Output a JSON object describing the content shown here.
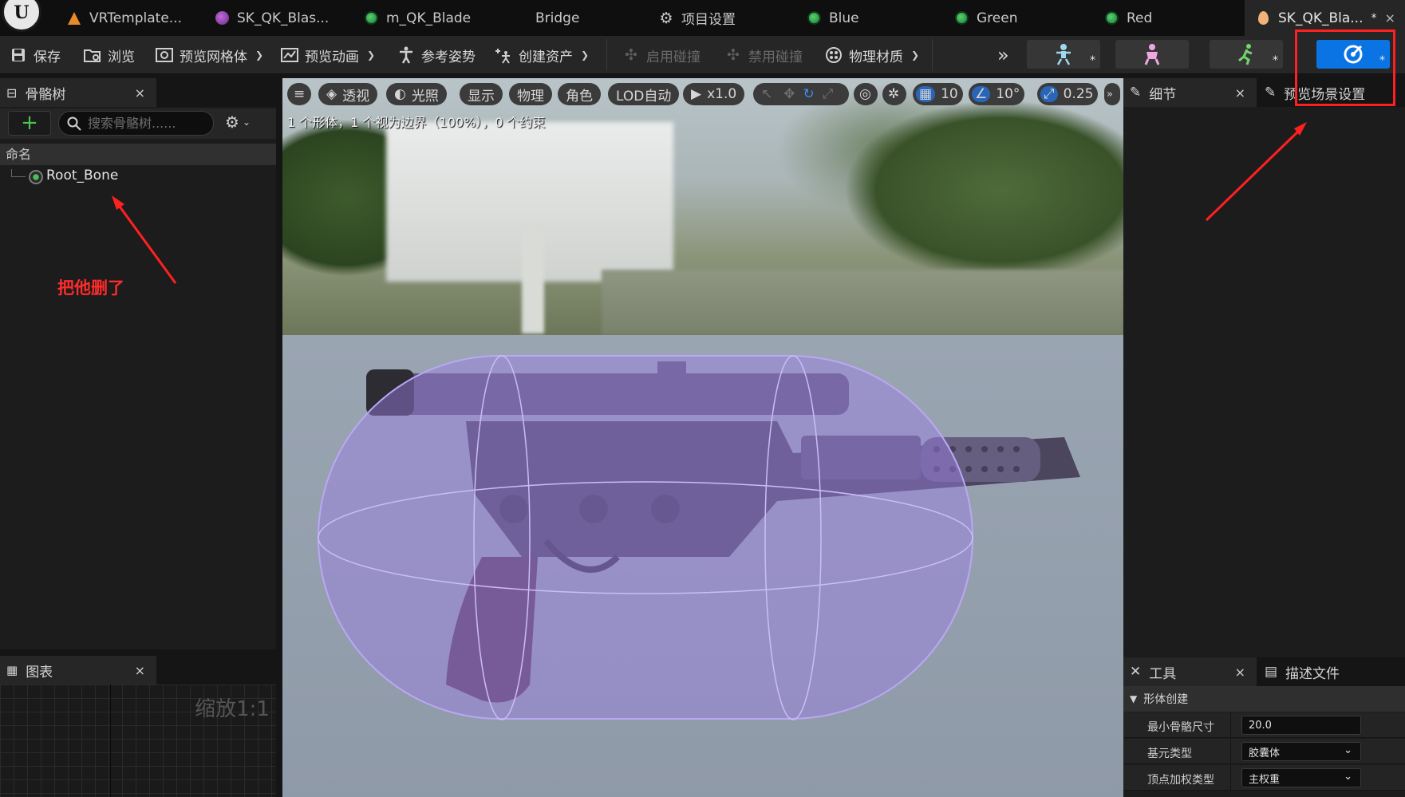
{
  "tabs": [
    {
      "label": "VRTemplate...",
      "icon": "cone-icon"
    },
    {
      "label": "SK_QK_Blas...",
      "icon": "material-instance-icon"
    },
    {
      "label": "m_QK_Blade",
      "icon": "material-icon"
    },
    {
      "label": "Bridge",
      "icon": ""
    },
    {
      "label": "项目设置",
      "icon": "gear-icon"
    },
    {
      "label": "Blue",
      "icon": "material-icon"
    },
    {
      "label": "Green",
      "icon": "material-icon"
    },
    {
      "label": "Red",
      "icon": "material-icon"
    },
    {
      "label": "SK_QK_Bla...",
      "icon": "physics-asset-icon",
      "modified": "*",
      "close": "×"
    }
  ],
  "toolbar": {
    "save": "保存",
    "browse": "浏览",
    "preview_mesh": "预览网格体",
    "preview_anim": "预览动画",
    "ref_pose": "参考姿势",
    "create_asset": "创建资产",
    "enable_collision": "启用碰撞",
    "disable_collision": "禁用碰撞",
    "physical_material": "物理材质",
    "mode_star": "*"
  },
  "skeleton_panel": {
    "title": "骨骼树",
    "close": "×",
    "add": "+",
    "search_placeholder": "搜索骨骼树......",
    "column_name": "命名",
    "root_bone": "Root_Bone"
  },
  "graph_panel": {
    "title": "图表",
    "close": "×",
    "zoom": "缩放1:1"
  },
  "viewport": {
    "perspective": "透视",
    "lighting": "光照",
    "show": "显示",
    "physics": "物理",
    "character": "角色",
    "lod": "LOD自动",
    "play_speed": "x1.0",
    "grid_size": "10",
    "rotation_snap": "10°",
    "scale_snap": "0.25",
    "stats": "1 个形体，1 个视为边界（100%），0 个约束"
  },
  "details_panel": {
    "tab_details": "细节",
    "close": "×",
    "tab_preview_scene": "预览场景设置"
  },
  "tools_panel": {
    "tab_tools": "工具",
    "close": "×",
    "tab_profile": "描述文件",
    "section": "形体创建",
    "rows": [
      {
        "label": "最小骨骼尺寸",
        "value": "20.0"
      },
      {
        "label": "基元类型",
        "value": "胶囊体"
      },
      {
        "label": "顶点加权类型",
        "value": "主权重"
      }
    ]
  },
  "annotation": {
    "text": "把他删了",
    "color": "#ff2b2b"
  },
  "colors": {
    "accent": "#0b74e5",
    "physics_body": "#9b7fe6"
  }
}
